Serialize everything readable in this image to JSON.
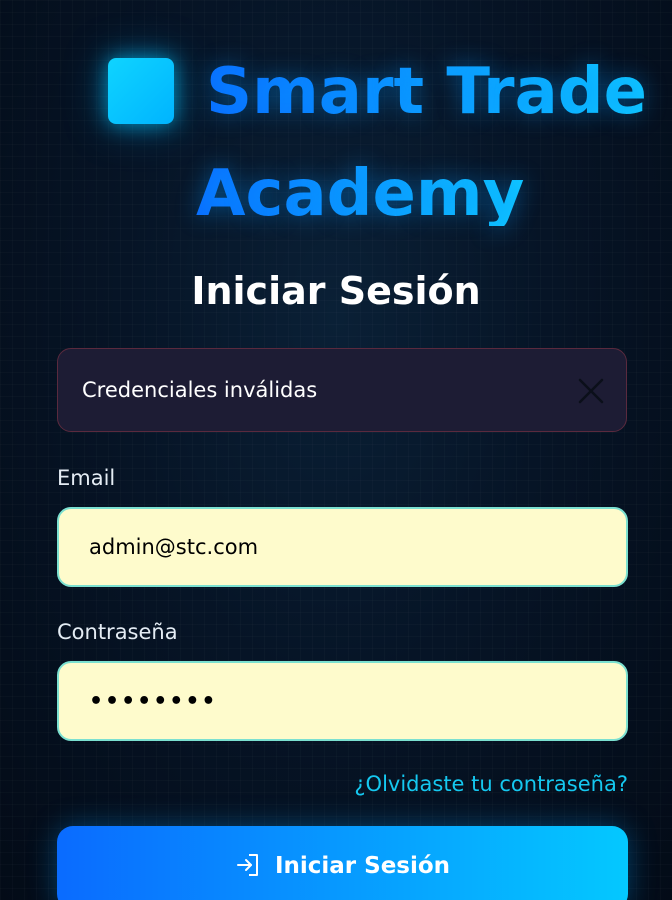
{
  "brand": {
    "line1": "Smart Trade",
    "line2": "Academy",
    "logo_icon": "square-logo-icon",
    "accent_color": "#00b4ff"
  },
  "page": {
    "title": "Iniciar Sesión"
  },
  "alert": {
    "message": "Credenciales inválidas",
    "close_icon": "close-icon"
  },
  "form": {
    "email": {
      "label": "Email",
      "value": "admin@stc.com"
    },
    "password": {
      "label": "Contraseña",
      "masked_value": "••••••••"
    },
    "forgot_link": "¿Olvidaste tu contraseña?",
    "submit": {
      "label": "Iniciar Sesión",
      "icon": "login-icon"
    }
  }
}
